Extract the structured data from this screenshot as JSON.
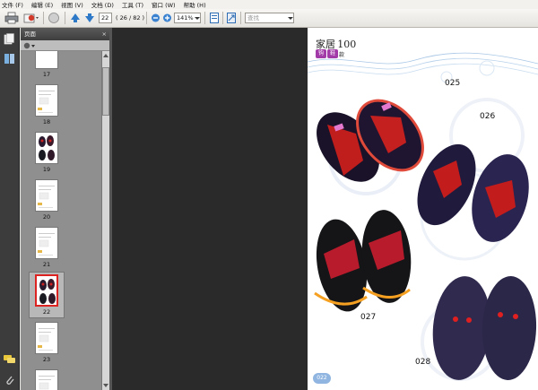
{
  "menu": [
    "文件 (F)",
    "编辑 (E)",
    "视图 (V)",
    "文档 (D)",
    "工具 (T)",
    "窗口 (W)",
    "帮助 (H)"
  ],
  "toolbar": {
    "page_number": "22",
    "page_total": "( 26 / 82 )",
    "zoom": "141%",
    "search_placeholder": "查找"
  },
  "panel": {
    "title": "页面",
    "close": "×"
  },
  "thumbnails": [
    {
      "label": "17",
      "kind": "plain"
    },
    {
      "label": "18",
      "kind": "text"
    },
    {
      "label": "19",
      "kind": "slippers"
    },
    {
      "label": "20",
      "kind": "text"
    },
    {
      "label": "21",
      "kind": "text"
    },
    {
      "label": "22",
      "kind": "slippers",
      "selected": true
    },
    {
      "label": "23",
      "kind": "text"
    },
    {
      "label": "",
      "kind": "text"
    }
  ],
  "page": {
    "title": "家居",
    "title_num": "100",
    "subtitle_chars": [
      "钩",
      "鞋"
    ],
    "subtitle_suffix": "款",
    "labels": [
      "025",
      "026",
      "027",
      "028"
    ],
    "page_badge": "022"
  }
}
